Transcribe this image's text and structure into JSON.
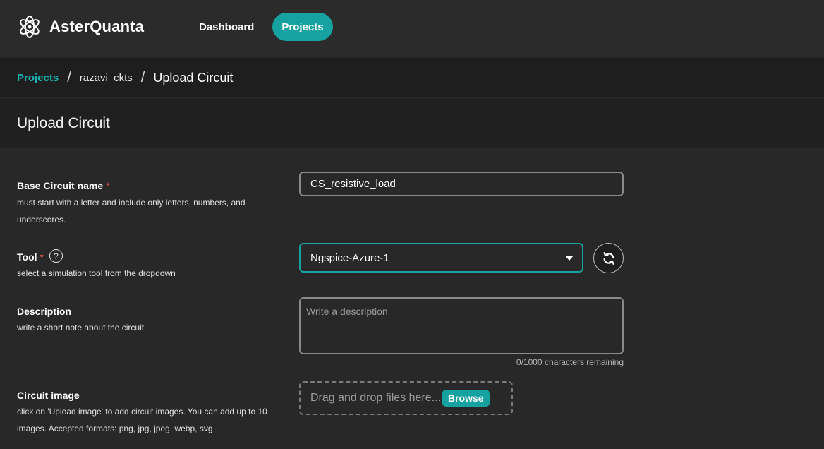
{
  "app": {
    "name": "AsterQuanta"
  },
  "nav": {
    "dashboard": "Dashboard",
    "projects": "Projects"
  },
  "breadcrumb": {
    "root": "Projects",
    "separator": "/",
    "project": "razavi_ckts",
    "current": "Upload Circuit"
  },
  "page": {
    "title": "Upload Circuit"
  },
  "form": {
    "name": {
      "label": "Base Circuit name",
      "required": "*",
      "hint": "must start with a letter and include only letters, numbers, and underscores.",
      "value": "CS_resistive_load"
    },
    "tool": {
      "label": "Tool",
      "required": "*",
      "help": "?",
      "hint": "select a simulation tool from the dropdown",
      "value": "Ngspice-Azure-1"
    },
    "description": {
      "label": "Description",
      "hint": "write a short note about the circuit",
      "placeholder": "Write a description",
      "counter": "0/1000 characters remaining"
    },
    "image": {
      "label": "Circuit image",
      "hint": "click on 'Upload image' to add circuit images. You can add up to 10 images. Accepted formats: png, jpg, jpeg, webp, svg",
      "dropzone_text": "Drag and drop files here...",
      "browse_label": "Browse"
    }
  },
  "colors": {
    "accent": "#17a2a2",
    "required": "#e05656",
    "background": "#282828"
  },
  "icons": {
    "logo": "atom-logo-icon",
    "refresh": "refresh-icon",
    "dropdown": "chevron-down-icon",
    "help": "help-icon"
  }
}
